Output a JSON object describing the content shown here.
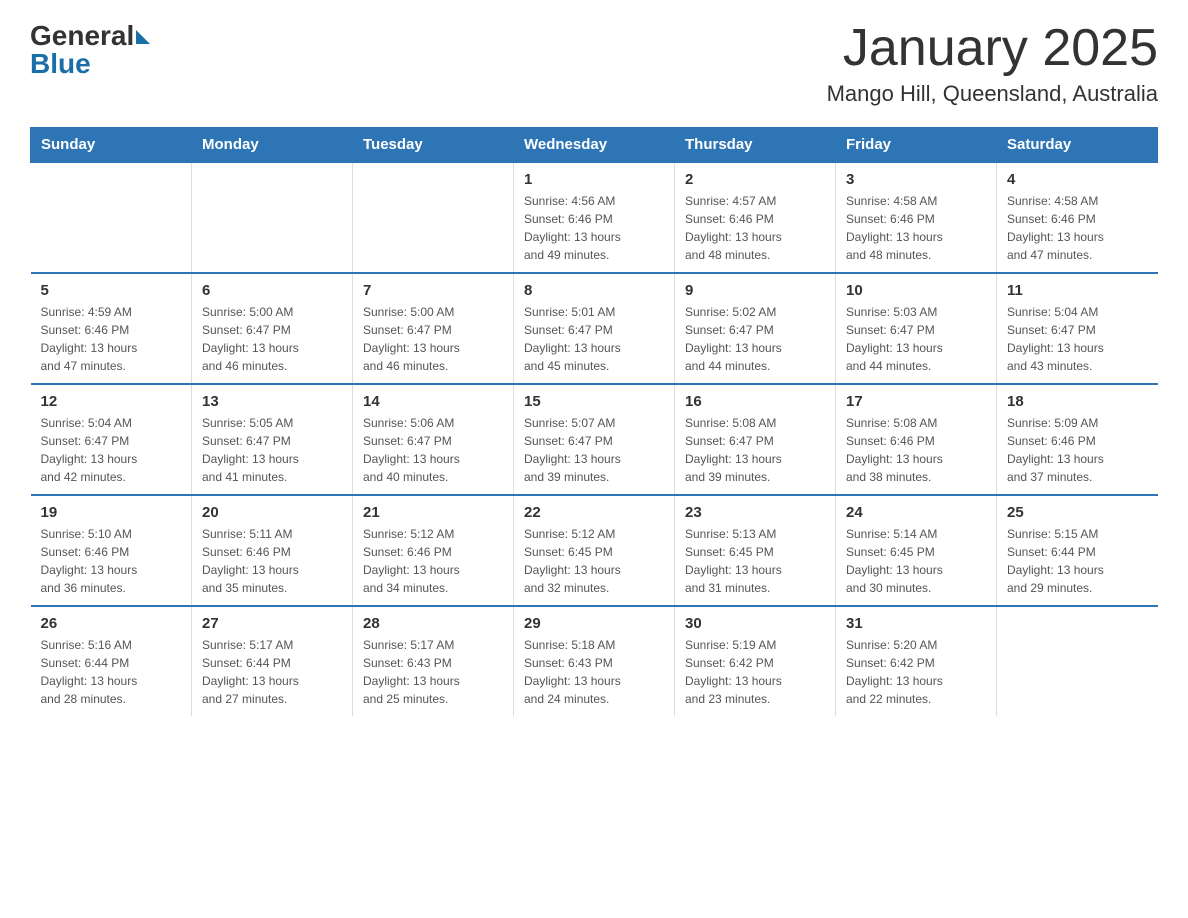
{
  "header": {
    "logo_general": "General",
    "logo_blue": "Blue",
    "title": "January 2025",
    "subtitle": "Mango Hill, Queensland, Australia"
  },
  "weekdays": [
    "Sunday",
    "Monday",
    "Tuesday",
    "Wednesday",
    "Thursday",
    "Friday",
    "Saturday"
  ],
  "weeks": [
    [
      {
        "day": "",
        "info": ""
      },
      {
        "day": "",
        "info": ""
      },
      {
        "day": "",
        "info": ""
      },
      {
        "day": "1",
        "info": "Sunrise: 4:56 AM\nSunset: 6:46 PM\nDaylight: 13 hours\nand 49 minutes."
      },
      {
        "day": "2",
        "info": "Sunrise: 4:57 AM\nSunset: 6:46 PM\nDaylight: 13 hours\nand 48 minutes."
      },
      {
        "day": "3",
        "info": "Sunrise: 4:58 AM\nSunset: 6:46 PM\nDaylight: 13 hours\nand 48 minutes."
      },
      {
        "day": "4",
        "info": "Sunrise: 4:58 AM\nSunset: 6:46 PM\nDaylight: 13 hours\nand 47 minutes."
      }
    ],
    [
      {
        "day": "5",
        "info": "Sunrise: 4:59 AM\nSunset: 6:46 PM\nDaylight: 13 hours\nand 47 minutes."
      },
      {
        "day": "6",
        "info": "Sunrise: 5:00 AM\nSunset: 6:47 PM\nDaylight: 13 hours\nand 46 minutes."
      },
      {
        "day": "7",
        "info": "Sunrise: 5:00 AM\nSunset: 6:47 PM\nDaylight: 13 hours\nand 46 minutes."
      },
      {
        "day": "8",
        "info": "Sunrise: 5:01 AM\nSunset: 6:47 PM\nDaylight: 13 hours\nand 45 minutes."
      },
      {
        "day": "9",
        "info": "Sunrise: 5:02 AM\nSunset: 6:47 PM\nDaylight: 13 hours\nand 44 minutes."
      },
      {
        "day": "10",
        "info": "Sunrise: 5:03 AM\nSunset: 6:47 PM\nDaylight: 13 hours\nand 44 minutes."
      },
      {
        "day": "11",
        "info": "Sunrise: 5:04 AM\nSunset: 6:47 PM\nDaylight: 13 hours\nand 43 minutes."
      }
    ],
    [
      {
        "day": "12",
        "info": "Sunrise: 5:04 AM\nSunset: 6:47 PM\nDaylight: 13 hours\nand 42 minutes."
      },
      {
        "day": "13",
        "info": "Sunrise: 5:05 AM\nSunset: 6:47 PM\nDaylight: 13 hours\nand 41 minutes."
      },
      {
        "day": "14",
        "info": "Sunrise: 5:06 AM\nSunset: 6:47 PM\nDaylight: 13 hours\nand 40 minutes."
      },
      {
        "day": "15",
        "info": "Sunrise: 5:07 AM\nSunset: 6:47 PM\nDaylight: 13 hours\nand 39 minutes."
      },
      {
        "day": "16",
        "info": "Sunrise: 5:08 AM\nSunset: 6:47 PM\nDaylight: 13 hours\nand 39 minutes."
      },
      {
        "day": "17",
        "info": "Sunrise: 5:08 AM\nSunset: 6:46 PM\nDaylight: 13 hours\nand 38 minutes."
      },
      {
        "day": "18",
        "info": "Sunrise: 5:09 AM\nSunset: 6:46 PM\nDaylight: 13 hours\nand 37 minutes."
      }
    ],
    [
      {
        "day": "19",
        "info": "Sunrise: 5:10 AM\nSunset: 6:46 PM\nDaylight: 13 hours\nand 36 minutes."
      },
      {
        "day": "20",
        "info": "Sunrise: 5:11 AM\nSunset: 6:46 PM\nDaylight: 13 hours\nand 35 minutes."
      },
      {
        "day": "21",
        "info": "Sunrise: 5:12 AM\nSunset: 6:46 PM\nDaylight: 13 hours\nand 34 minutes."
      },
      {
        "day": "22",
        "info": "Sunrise: 5:12 AM\nSunset: 6:45 PM\nDaylight: 13 hours\nand 32 minutes."
      },
      {
        "day": "23",
        "info": "Sunrise: 5:13 AM\nSunset: 6:45 PM\nDaylight: 13 hours\nand 31 minutes."
      },
      {
        "day": "24",
        "info": "Sunrise: 5:14 AM\nSunset: 6:45 PM\nDaylight: 13 hours\nand 30 minutes."
      },
      {
        "day": "25",
        "info": "Sunrise: 5:15 AM\nSunset: 6:44 PM\nDaylight: 13 hours\nand 29 minutes."
      }
    ],
    [
      {
        "day": "26",
        "info": "Sunrise: 5:16 AM\nSunset: 6:44 PM\nDaylight: 13 hours\nand 28 minutes."
      },
      {
        "day": "27",
        "info": "Sunrise: 5:17 AM\nSunset: 6:44 PM\nDaylight: 13 hours\nand 27 minutes."
      },
      {
        "day": "28",
        "info": "Sunrise: 5:17 AM\nSunset: 6:43 PM\nDaylight: 13 hours\nand 25 minutes."
      },
      {
        "day": "29",
        "info": "Sunrise: 5:18 AM\nSunset: 6:43 PM\nDaylight: 13 hours\nand 24 minutes."
      },
      {
        "day": "30",
        "info": "Sunrise: 5:19 AM\nSunset: 6:42 PM\nDaylight: 13 hours\nand 23 minutes."
      },
      {
        "day": "31",
        "info": "Sunrise: 5:20 AM\nSunset: 6:42 PM\nDaylight: 13 hours\nand 22 minutes."
      },
      {
        "day": "",
        "info": ""
      }
    ]
  ]
}
